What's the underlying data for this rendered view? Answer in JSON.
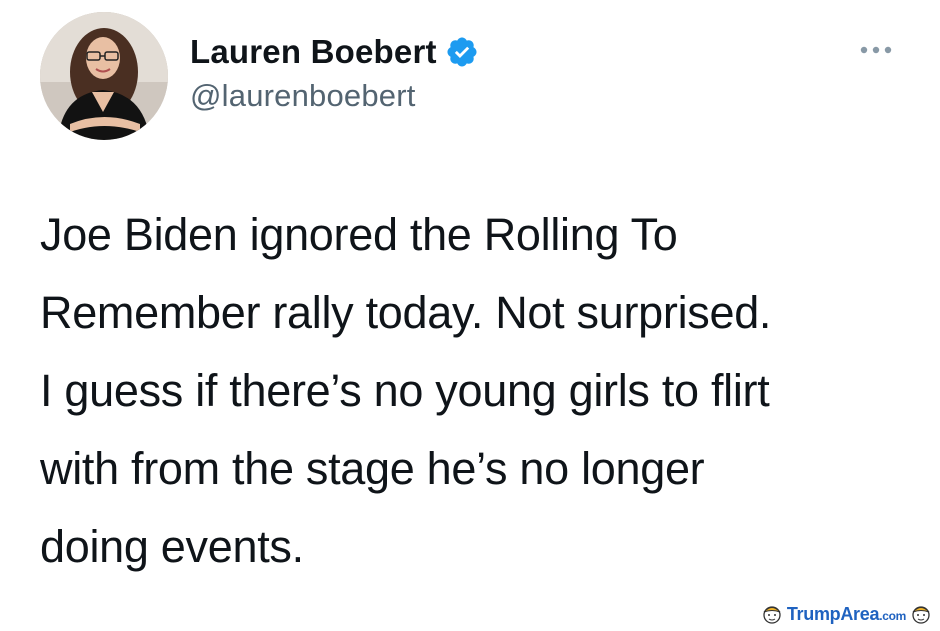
{
  "tweet": {
    "author": {
      "display_name": "Lauren Boebert",
      "handle": "@laurenboebert",
      "verified": true,
      "avatar_icon": "profile-photo"
    },
    "more_icon": "more-dots-icon",
    "text": "Joe Biden ignored the Rolling To\nRemember rally today. Not surprised.\nI guess if there’s no young girls to flirt\nwith from the stage he’s no longer\ndoing events."
  },
  "watermark": {
    "brand": "TrumpArea",
    "suffix": ".com",
    "color": "#1f62c0"
  },
  "colors": {
    "verified_blue": "#1d9bf0",
    "handle_gray": "#536471",
    "text_black": "#0f1419"
  }
}
